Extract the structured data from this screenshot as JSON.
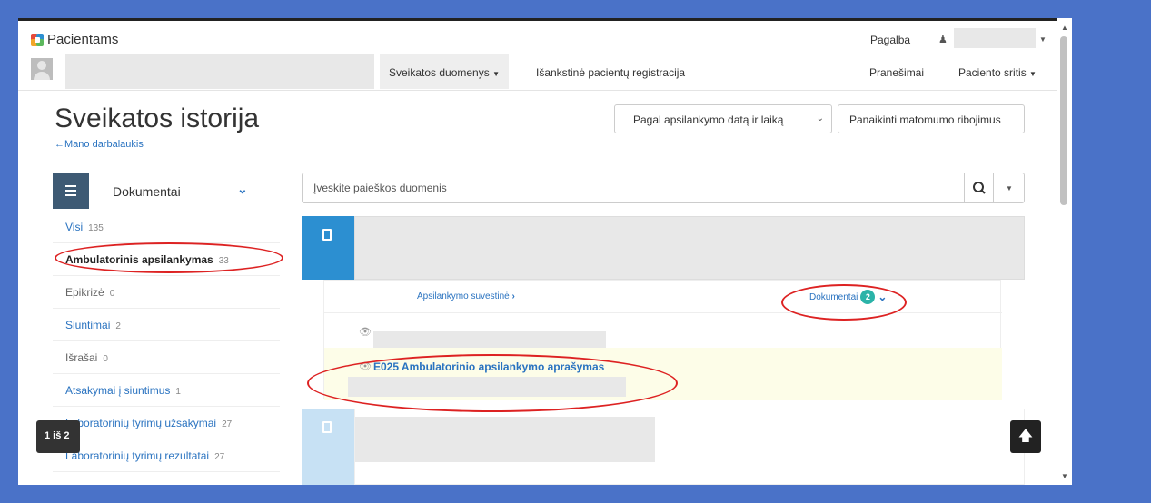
{
  "brand": "Pacientams",
  "topbar": {
    "help": "Pagalba"
  },
  "nav": {
    "items": [
      "Sveikatos duomenys",
      "Išankstinė pacientų registracija"
    ],
    "notifications": "Pranešimai",
    "patient_area": "Paciento sritis"
  },
  "header": {
    "title": "Sveikatos istorija",
    "back_link": "←Mano darbalaukis",
    "sort_select": "Pagal apsilankymo datą ir laiką",
    "clear_button": "Panaikinti matomumo ribojimus"
  },
  "sidebar": {
    "title": "Dokumentai",
    "items": [
      {
        "label": "Visi",
        "count": "135"
      },
      {
        "label": "Ambulatorinis apsilankymas",
        "count": "33"
      },
      {
        "label": "Epikrizė",
        "count": "0"
      },
      {
        "label": "Siuntimai",
        "count": "2"
      },
      {
        "label": "Išrašai",
        "count": "0"
      },
      {
        "label": "Atsakymai į siuntimus",
        "count": "1"
      },
      {
        "label": "Laboratorinių tyrimų užsakymai",
        "count": "27"
      },
      {
        "label": "Laboratorinių tyrimų rezultatai",
        "count": "27"
      }
    ]
  },
  "search": {
    "placeholder": "Įveskite paieškos duomenis"
  },
  "card": {
    "summary_link": "Apsilankymo suvestinė",
    "docs_link": "Dokumentai",
    "docs_count": "2",
    "document_title": "E025 Ambulatorinio apsilankymo aprašymas"
  },
  "pager": "1 iš 2",
  "colors": {
    "accent": "#2c8fd1",
    "link": "#2a73c0",
    "badge": "#2bb3a8",
    "annotation": "#dd2222",
    "background": "#4a72c8"
  }
}
